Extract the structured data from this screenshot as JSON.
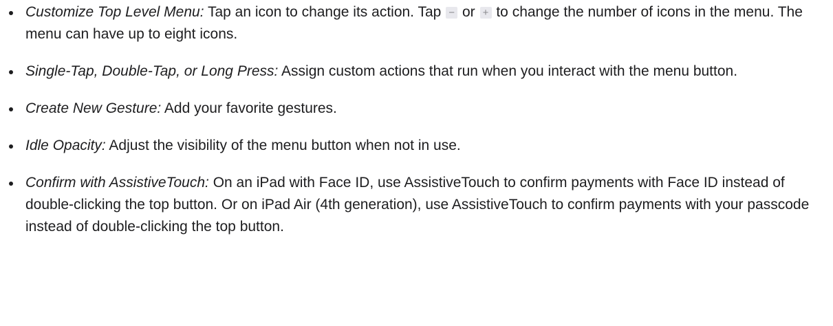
{
  "items": [
    {
      "term": "Customize Top Level Menu:",
      "text_before": " Tap an icon to change its action. Tap ",
      "minus_glyph": "−",
      "text_mid": " or ",
      "plus_glyph": "+",
      "text_after": " to change the number of icons in the menu. The menu can have up to eight icons."
    },
    {
      "term": "Single-Tap, Double-Tap, or Long Press:",
      "text": " Assign custom actions that run when you interact with the menu button."
    },
    {
      "term": "Create New Gesture:",
      "text": " Add your favorite gestures."
    },
    {
      "term": "Idle Opacity:",
      "text": " Adjust the visibility of the menu button when not in use."
    },
    {
      "term": "Confirm with AssistiveTouch:",
      "text": " On an iPad with Face ID, use AssistiveTouch to confirm payments with Face ID instead of double-clicking the top button. Or on iPad Air (4th generation), use AssistiveTouch to confirm payments with your passcode instead of double-clicking the top button."
    }
  ]
}
